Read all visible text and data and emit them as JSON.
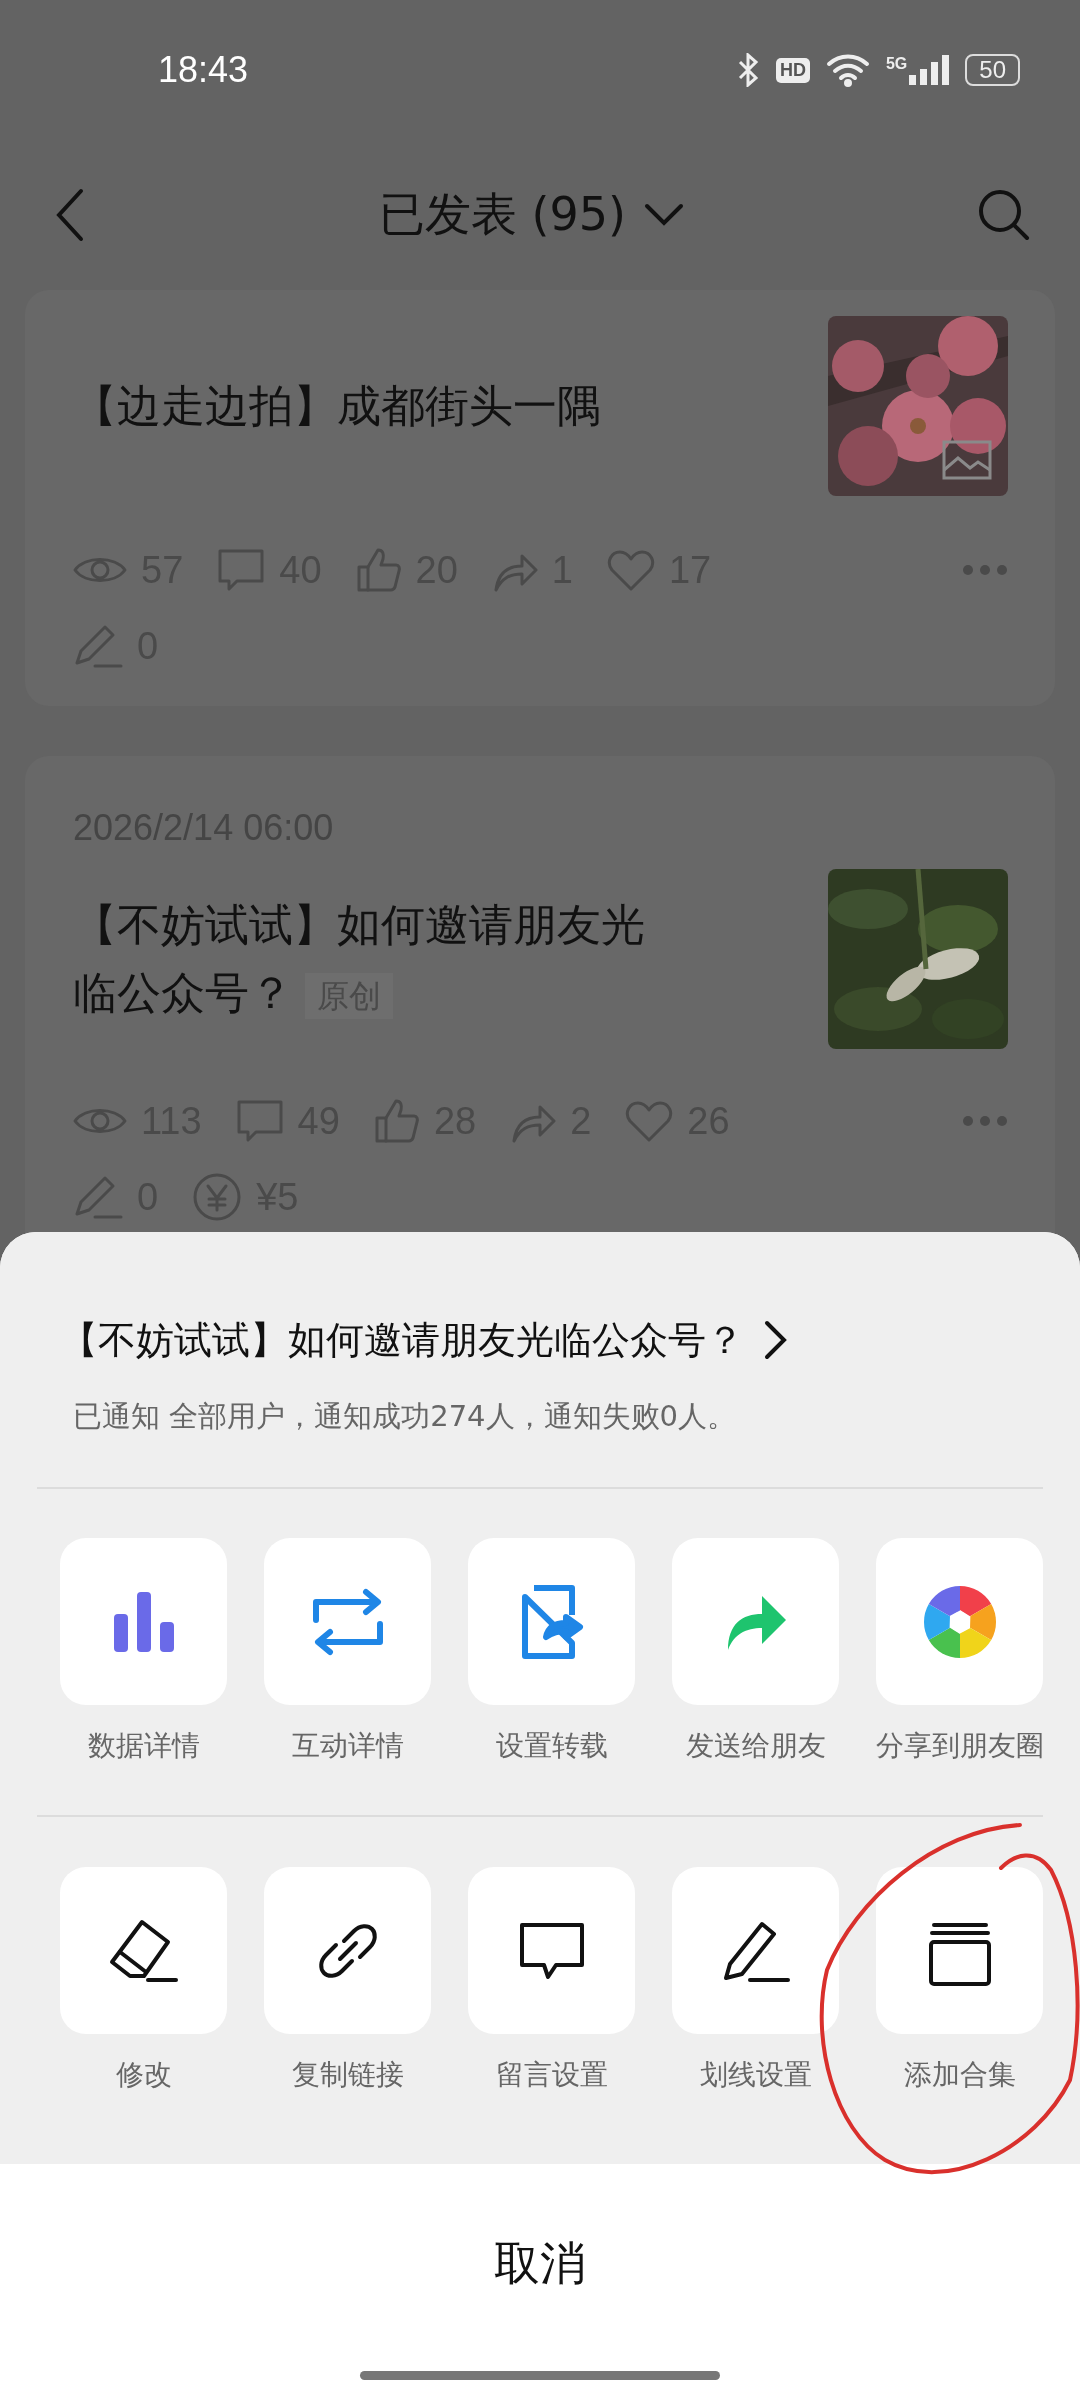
{
  "status_bar": {
    "time": "18:43",
    "hd_label": "HD",
    "network": "5G",
    "battery": "50"
  },
  "header": {
    "title": "已发表 (95)"
  },
  "articles": [
    {
      "title": "【边走边拍】成都街头一隅",
      "thumbnail": {
        "kind": "picture",
        "gallery": true
      },
      "stats": [
        {
          "kind": "views",
          "value": "57"
        },
        {
          "kind": "comments",
          "value": "40"
        },
        {
          "kind": "likes",
          "value": "20"
        },
        {
          "kind": "shares",
          "value": "1"
        },
        {
          "kind": "favorites",
          "value": "17"
        }
      ],
      "extra": [
        {
          "kind": "underlines",
          "value": "0"
        }
      ]
    },
    {
      "date": "2026/2/14 06:00",
      "title": "【不妨试试】如何邀请朋友光临公众号？",
      "badge": "原创",
      "thumbnail": {
        "kind": "picture"
      },
      "stats": [
        {
          "kind": "views",
          "value": "113"
        },
        {
          "kind": "comments",
          "value": "49"
        },
        {
          "kind": "likes",
          "value": "28"
        },
        {
          "kind": "shares",
          "value": "2"
        },
        {
          "kind": "favorites",
          "value": "26"
        }
      ],
      "extra": [
        {
          "kind": "underlines",
          "value": "0"
        },
        {
          "kind": "rewards",
          "value": "¥5"
        }
      ]
    }
  ],
  "sheet": {
    "title": "【不妨试试】如何邀请朋友光临公众号？",
    "notice": "已通知 全部用户，通知成功274人，通知失败0人。",
    "rows": [
      [
        {
          "kind": "data",
          "label": "数据详情"
        },
        {
          "kind": "interaction",
          "label": "互动详情"
        },
        {
          "kind": "repost",
          "label": "设置转载"
        },
        {
          "kind": "send",
          "label": "发送给朋友"
        },
        {
          "kind": "moments",
          "label": "分享到朋友圈"
        }
      ],
      [
        {
          "kind": "edit",
          "label": "修改"
        },
        {
          "kind": "link",
          "label": "复制链接"
        },
        {
          "kind": "comment",
          "label": "留言设置"
        },
        {
          "kind": "underline",
          "label": "划线设置"
        },
        {
          "kind": "collection",
          "label": "添加合集"
        }
      ]
    ],
    "cancel": "取消"
  }
}
